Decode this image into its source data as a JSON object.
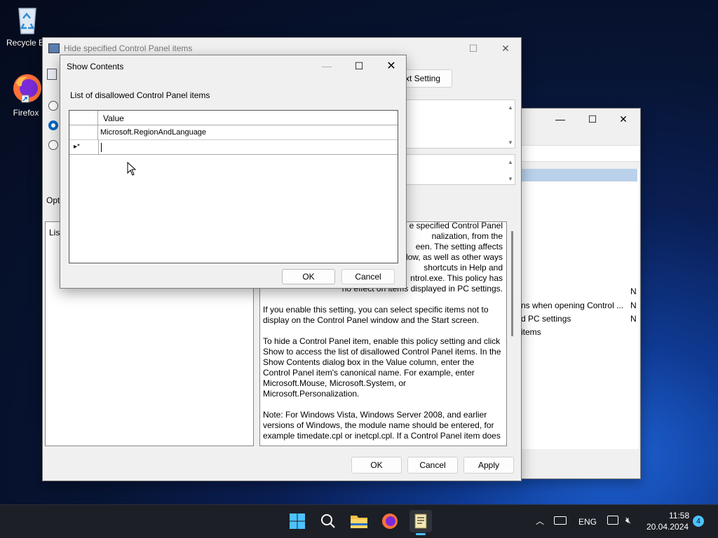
{
  "desktop": {
    "icons": [
      {
        "label": "Recycle Bin"
      },
      {
        "label": "Firefox"
      }
    ]
  },
  "bg_window": {
    "list_items": [
      {
        "text": "ns when opening Control ...",
        "state": "N"
      },
      {
        "text": "d PC settings",
        "state": "N"
      },
      {
        "text": "items",
        "state": ""
      }
    ],
    "first_state": "N"
  },
  "policy_window": {
    "title": "Hide specified Control Panel items",
    "setting_btn": "xt Setting",
    "options_label": "Opt",
    "list_label": "List",
    "help_paragraphs": [
      "e specified Control Panel\nnalization, from the\neen. The setting affects\nlow, as well as other ways\nshortcuts in Help and\nntrol.exe. This policy has\nno effect on items displayed in PC settings.",
      "If you enable this setting, you can select specific items not to display on the Control Panel window and the Start screen.",
      "To hide a Control Panel item, enable this policy setting and click Show to access the list of disallowed Control Panel items. In the Show Contents dialog box in the Value column, enter the Control Panel item's canonical name. For example, enter Microsoft.Mouse, Microsoft.System, or Microsoft.Personalization.",
      "Note: For Windows Vista, Windows Server 2008, and earlier versions of Windows, the module name should be entered, for example timedate.cpl or inetcpl.cpl. If a Control Panel item does"
    ],
    "ok": "OK",
    "cancel": "Cancel",
    "apply": "Apply"
  },
  "dialog": {
    "title": "Show Contents",
    "caption": "List of disallowed Control Panel items",
    "column_header": "Value",
    "rows": [
      {
        "value": "Microsoft.RegionAndLanguage"
      }
    ],
    "new_row_marker": "▸*",
    "ok": "OK",
    "cancel": "Cancel"
  },
  "taskbar": {
    "lang": "ENG",
    "time": "11:58",
    "date": "20.04.2024",
    "badge": "4"
  },
  "colors": {
    "accent": "#0067c0",
    "selection": "#cce4f7"
  }
}
